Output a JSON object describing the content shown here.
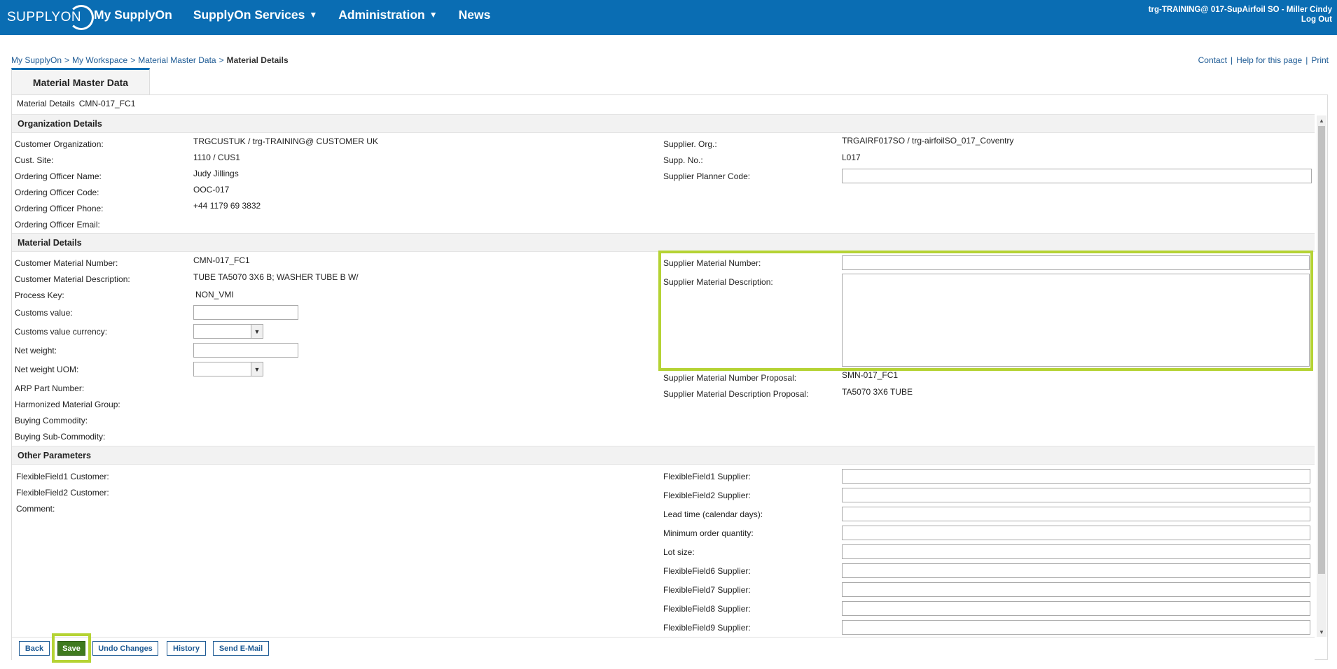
{
  "header": {
    "logo_text": "SUPPLYON",
    "nav": [
      {
        "label": "My SupplyOn",
        "has_caret": false
      },
      {
        "label": "SupplyOn Services",
        "has_caret": true
      },
      {
        "label": "Administration",
        "has_caret": true
      },
      {
        "label": "News",
        "has_caret": false
      }
    ],
    "user": "trg-TRAINING@ 017-SupAirfoil SO - Miller Cindy",
    "logout": "Log Out",
    "brand_color": "#0a6db3"
  },
  "breadcrumb": {
    "items": [
      "My SupplyOn",
      "My Workspace",
      "Material Master Data"
    ],
    "current": "Material Details",
    "separator": ">"
  },
  "top_links": [
    "Contact",
    "Help for this page",
    "Print"
  ],
  "tab": {
    "label": "Material Master Data"
  },
  "material_header": {
    "label": "Material Details",
    "value": "CMN-017_FC1"
  },
  "sections": {
    "organization": {
      "title": "Organization Details",
      "left": [
        {
          "label": "Customer Organization:",
          "value": "TRGCUSTUK / trg-TRAINING@ CUSTOMER UK"
        },
        {
          "label": "Cust. Site:",
          "value": "1110 / CUS1"
        },
        {
          "label": "Ordering Officer Name:",
          "value": "Judy Jillings"
        },
        {
          "label": "Ordering Officer Code:",
          "value": "OOC-017"
        },
        {
          "label": "Ordering Officer Phone:",
          "value": "+44 1179 69 3832"
        },
        {
          "label": "Ordering Officer Email:",
          "value": ""
        }
      ],
      "right": [
        {
          "label": "Supplier. Org.:",
          "value": "TRGAIRF017SO / trg-airfoilSO_017_Coventry"
        },
        {
          "label": "Supp. No.:",
          "value": "L017"
        },
        {
          "label": "Supplier Planner Code:",
          "input_value": ""
        }
      ]
    },
    "material": {
      "title": "Material Details",
      "left": [
        {
          "label": "Customer Material Number:",
          "value": "CMN-017_FC1"
        },
        {
          "label": "Customer Material Description:",
          "value": "TUBE TA5070 3X6 B; WASHER TUBE B W/"
        },
        {
          "label": "Process Key:",
          "value": "NON_VMI"
        },
        {
          "label": "Customs value:",
          "input_value": ""
        },
        {
          "label": "Customs value currency:",
          "select_value": ""
        },
        {
          "label": "Net weight:",
          "input_value": ""
        },
        {
          "label": "Net weight UOM:",
          "select_value": ""
        },
        {
          "label": "ARP Part Number:",
          "value": ""
        },
        {
          "label": "Harmonized Material Group:",
          "value": ""
        },
        {
          "label": "Buying Commodity:",
          "value": ""
        },
        {
          "label": "Buying Sub-Commodity:",
          "value": ""
        }
      ],
      "right": [
        {
          "label": "Supplier Material Number:",
          "input_value": ""
        },
        {
          "label": "Supplier Material Description:",
          "textarea_value": ""
        },
        {
          "label": "Supplier Material Number Proposal:",
          "value": "SMN-017_FC1"
        },
        {
          "label": "Supplier Material Description Proposal:",
          "value": "TA5070 3X6 TUBE"
        }
      ]
    },
    "other": {
      "title": "Other Parameters",
      "left": [
        {
          "label": "FlexibleField1 Customer:",
          "value": ""
        },
        {
          "label": "FlexibleField2 Customer:",
          "value": ""
        },
        {
          "label": "Comment:",
          "value": ""
        }
      ],
      "right": [
        {
          "label": "FlexibleField1 Supplier:",
          "input_value": ""
        },
        {
          "label": "FlexibleField2 Supplier:",
          "input_value": ""
        },
        {
          "label": "Lead time (calendar days):",
          "input_value": ""
        },
        {
          "label": "Minimum order quantity:",
          "input_value": ""
        },
        {
          "label": "Lot size:",
          "input_value": ""
        },
        {
          "label": "FlexibleField6 Supplier:",
          "input_value": ""
        },
        {
          "label": "FlexibleField7 Supplier:",
          "input_value": ""
        },
        {
          "label": "FlexibleField8 Supplier:",
          "input_value": ""
        },
        {
          "label": "FlexibleField9 Supplier:",
          "input_value": ""
        }
      ]
    }
  },
  "buttons": {
    "back": "Back",
    "save": "Save",
    "undo": "Undo Changes",
    "history": "History",
    "send_email": "Send E-Mail"
  },
  "highlight_color": "#b5d334"
}
